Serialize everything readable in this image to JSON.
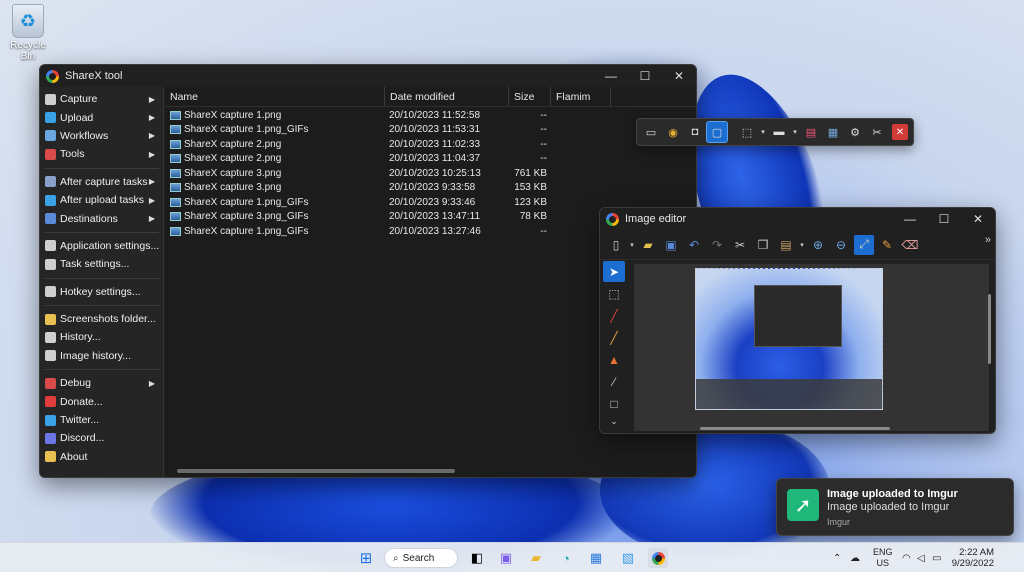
{
  "desktop": {
    "icons": [
      {
        "label": "Recycle Bin",
        "icon": "recycle-bin-icon"
      }
    ]
  },
  "sharex": {
    "title": "ShareX tool",
    "menu": [
      {
        "label": "Capture",
        "icon": "camera-icon",
        "submenu": true,
        "color": "#cfcfcf"
      },
      {
        "label": "Upload",
        "icon": "upload-arrow-icon",
        "submenu": true,
        "color": "#3aa3e8"
      },
      {
        "label": "Workflows",
        "icon": "workflow-icon",
        "submenu": true,
        "color": "#6aa7e0"
      },
      {
        "label": "Tools",
        "icon": "toolbox-icon",
        "submenu": true,
        "color": "#d94a4a"
      },
      {
        "sep": true
      },
      {
        "label": "After capture tasks",
        "icon": "image-task-icon",
        "submenu": true,
        "color": "#8aa0c8"
      },
      {
        "label": "After upload tasks",
        "icon": "upload-task-icon",
        "submenu": true,
        "color": "#3aa3e8"
      },
      {
        "label": "Destinations",
        "icon": "globe-icon",
        "submenu": true,
        "color": "#5b8bd8"
      },
      {
        "sep": true
      },
      {
        "label": "Application settings...",
        "icon": "wrench-icon",
        "submenu": false,
        "color": "#cfcfcf"
      },
      {
        "label": "Task settings...",
        "icon": "gear-icon",
        "submenu": false,
        "color": "#cfcfcf"
      },
      {
        "sep": true
      },
      {
        "label": "Hotkey settings...",
        "icon": "keyboard-icon",
        "submenu": false,
        "color": "#cfcfcf"
      },
      {
        "sep": true
      },
      {
        "label": "Screenshots folder...",
        "icon": "folder-icon",
        "submenu": false,
        "color": "#e8c050"
      },
      {
        "label": "History...",
        "icon": "history-icon",
        "submenu": false,
        "color": "#cfcfcf"
      },
      {
        "label": "Image history...",
        "icon": "image-history-icon",
        "submenu": false,
        "color": "#cfcfcf"
      },
      {
        "sep": true
      },
      {
        "label": "Debug",
        "icon": "bug-icon",
        "submenu": true,
        "color": "#d94a4a"
      },
      {
        "label": "Donate...",
        "icon": "heart-icon",
        "submenu": false,
        "color": "#e03c3c"
      },
      {
        "label": "Twitter...",
        "icon": "twitter-icon",
        "submenu": false,
        "color": "#3aa3e8"
      },
      {
        "label": "Discord...",
        "icon": "discord-icon",
        "submenu": false,
        "color": "#6b76e8"
      },
      {
        "label": "About",
        "icon": "star-badge-icon",
        "submenu": false,
        "color": "#e8c050"
      }
    ],
    "columns": [
      "Name",
      "Date modified",
      "Size",
      "Flamim"
    ],
    "files": [
      {
        "name": "ShareX capture 1.png",
        "date": "20/10/2023 11:52:58",
        "size": "--"
      },
      {
        "name": "ShareX capture 1.png_GIFs",
        "date": "20/10/2023 11:53:31",
        "size": "--"
      },
      {
        "name": "ShareX capture 2.png",
        "date": "20/10/2023 11:02:33",
        "size": "--"
      },
      {
        "name": "ShareX capture 2.png",
        "date": "20/10/2023 11:04:37",
        "size": "--"
      },
      {
        "name": "ShareX capture 3.png",
        "date": "20/10/2023 10:25:13",
        "size": "761 KB"
      },
      {
        "name": "ShareX capture 3.png",
        "date": "20/10/2023 9:33:58",
        "size": "153 KB"
      },
      {
        "name": "ShareX capture 1.png_GIFs",
        "date": "20/10/2023 9:33:46",
        "size": "123 KB"
      },
      {
        "name": "ShareX capture 3.png_GIFs",
        "date": "20/10/2023 13:47:11",
        "size": "78 KB"
      },
      {
        "name": "ShareX capture 1.png_GIFs",
        "date": "20/10/2023 13:27:46",
        "size": "--"
      }
    ]
  },
  "capture_toolbar": {
    "tools": [
      "window-icon",
      "chrome-icon",
      "camera-icon",
      "region-icon",
      "dashed-rect-icon",
      "monitor-icon",
      "screen-color-icon",
      "image-icon",
      "gear-icon",
      "scissors-tools-icon",
      "close-icon"
    ]
  },
  "editor": {
    "title": "Image editor",
    "more": "»"
  },
  "toast": {
    "title": "Image uploaded to Imgur",
    "message": "Image uploaded to Imgur",
    "source": "Imgur"
  },
  "taskbar": {
    "search_label": "Search",
    "lang_top": "ENG",
    "lang_bottom": "US",
    "time": "2:22 AM",
    "date": "9/29/2022"
  },
  "colors": {
    "accent": "#1c6fd1",
    "window_bg": "#202020",
    "toast_icon": "#1fb87a"
  }
}
